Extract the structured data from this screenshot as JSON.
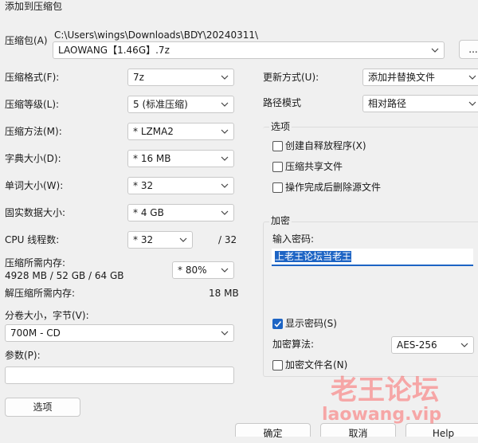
{
  "window": {
    "title": "添加到压缩包"
  },
  "archive": {
    "label": "压缩包(A)",
    "path": "C:\\Users\\wings\\Downloads\\BDY\\20240311\\",
    "name": "LAOWANG【1.46G】.7z",
    "browse_label": "..."
  },
  "left": {
    "format": {
      "label": "压缩格式(F):",
      "value": "7z"
    },
    "level": {
      "label": "压缩等级(L):",
      "value": "5 (标准压缩)"
    },
    "method": {
      "label": "压缩方法(M):",
      "value": "*  LZMA2"
    },
    "dict": {
      "label": "字典大小(D):",
      "value": "*  16 MB"
    },
    "word": {
      "label": "单词大小(W):",
      "value": "*  32"
    },
    "solid": {
      "label": "固实数据大小:",
      "value": "*  4 GB"
    },
    "threads": {
      "label": "CPU 线程数:",
      "value": "*  32",
      "max": "/ 32"
    },
    "mem_comp": {
      "label": "压缩所需内存:",
      "detail": "4928 MB / 52 GB / 64 GB",
      "value": "* 80%"
    },
    "mem_decomp": {
      "label": "解压缩所需内存:",
      "value": "18 MB"
    },
    "split": {
      "label": "分卷大小，字节(V):",
      "value": "700M - CD"
    },
    "params": {
      "label": "参数(P):",
      "value": ""
    },
    "options_button": "选项"
  },
  "right": {
    "update": {
      "label": "更新方式(U):",
      "value": "添加并替换文件"
    },
    "pathmode": {
      "label": "路径模式",
      "value": "相对路径"
    },
    "options": {
      "title": "选项",
      "sfx": {
        "label": "创建自释放程序(X)",
        "checked": false
      },
      "shared": {
        "label": "压缩共享文件",
        "checked": false
      },
      "delete": {
        "label": "操作完成后删除源文件",
        "checked": false
      }
    },
    "encryption": {
      "title": "加密",
      "password_label": "输入密码:",
      "password_value": "上老王论坛当老王",
      "show_password": {
        "label": "显示密码(S)",
        "checked": true
      },
      "method_label": "加密算法:",
      "method_value": "AES-256",
      "encrypt_names": {
        "label": "加密文件名(N)",
        "checked": false
      }
    }
  },
  "footer": {
    "ok": "确定",
    "cancel": "取消",
    "help": "Help"
  },
  "watermark": {
    "line1": "老王论坛",
    "line2": "laowang.vip"
  },
  "colors": {
    "selection": "#1d64c4",
    "watermark": "#ff4d4d"
  }
}
